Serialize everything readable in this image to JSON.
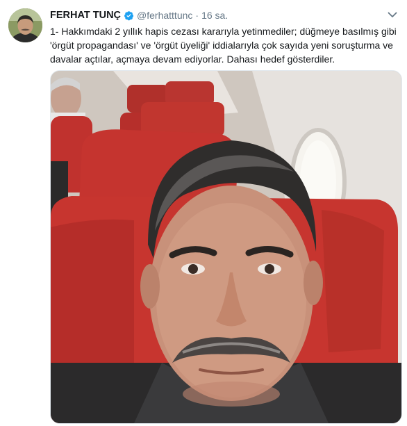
{
  "tweet": {
    "author_name": "FERHAT TUNÇ",
    "handle": "@ferhatttunc",
    "separator": "·",
    "time": "16 sa.",
    "text": "1- Hakkımdaki 2 yıllık hapis cezası kararıyla yetinmediler; düğmeye basılmış gibi 'örgüt propagandası' ve 'örgüt üyeliği' iddialarıyla çok sayıda yeni soruşturma ve davalar açtılar, açmaya devam ediyorlar. Dahası hedef gösterdiler.",
    "verified_icon": "verified-badge-icon",
    "menu_icon": "chevron-down-icon"
  },
  "colors": {
    "verified_blue": "#1da1f2",
    "muted_text": "#657786",
    "seat_red": "#c0322e"
  }
}
